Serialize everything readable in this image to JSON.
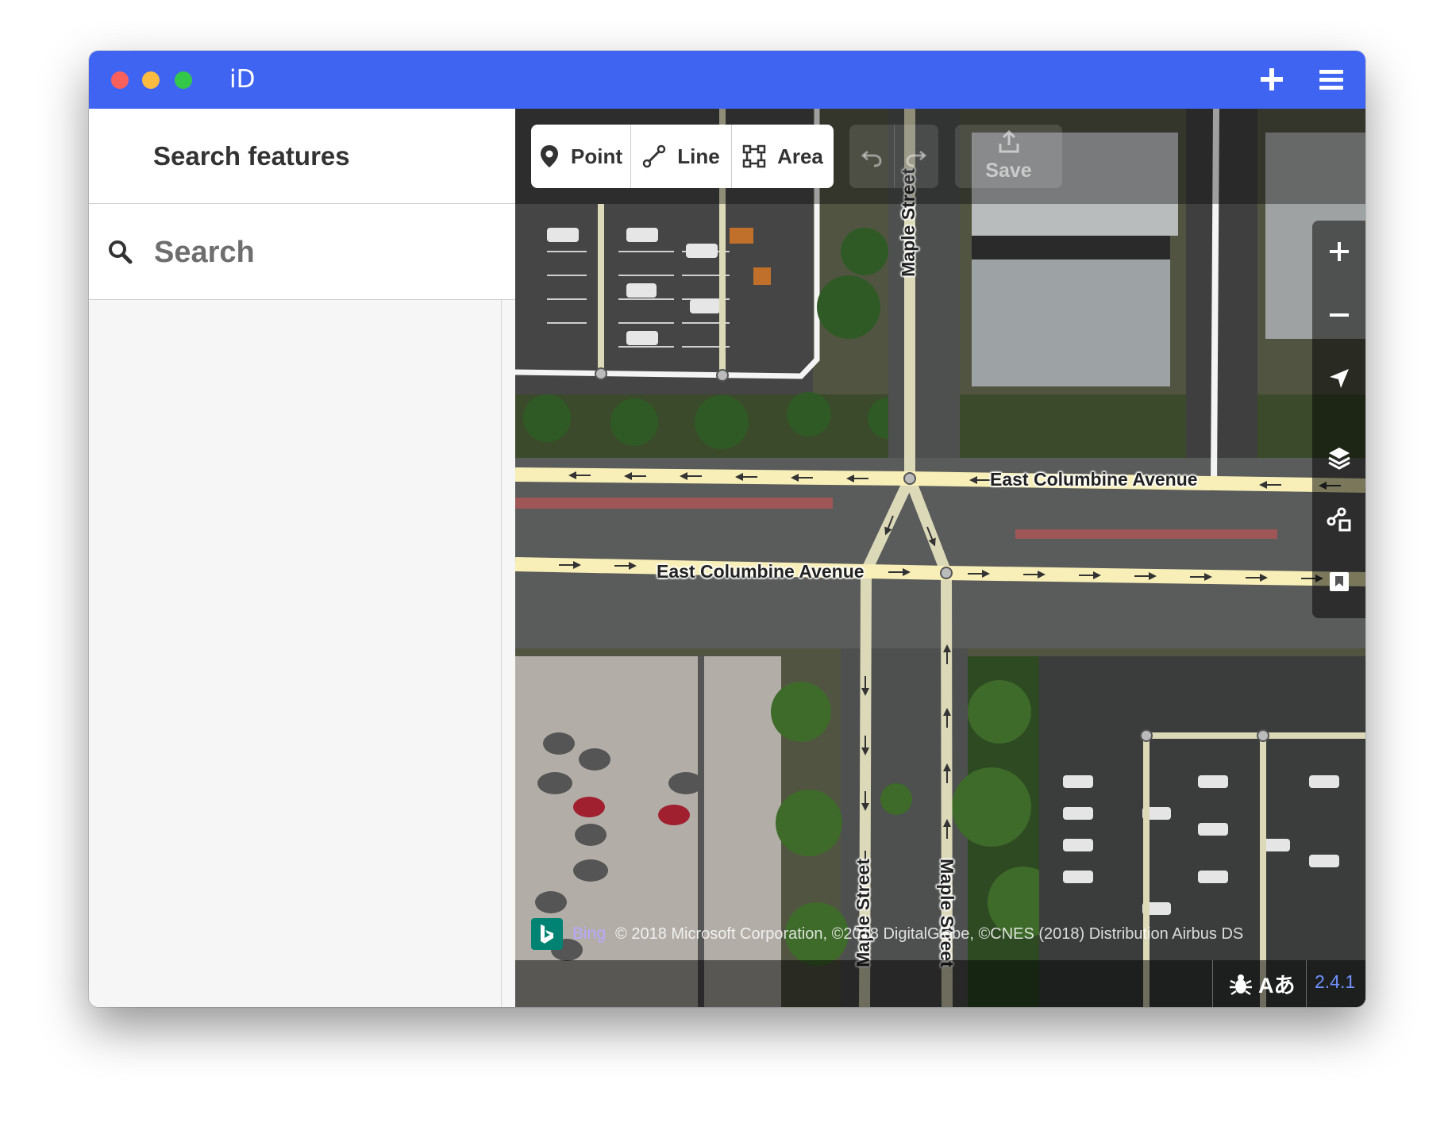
{
  "app": {
    "title": "iD"
  },
  "sidebar": {
    "title": "Search features",
    "search": {
      "placeholder": "Search",
      "value": ""
    }
  },
  "toolbar": {
    "modes": [
      {
        "label": "Point",
        "icon": "point-marker-icon"
      },
      {
        "label": "Line",
        "icon": "line-icon"
      },
      {
        "label": "Area",
        "icon": "area-icon"
      }
    ],
    "undo_icon": "undo-icon",
    "redo_icon": "redo-icon",
    "save_label": "Save",
    "save_icon": "save-upload-icon"
  },
  "map": {
    "road_labels": {
      "maple_north": "Maple Street",
      "columbine_north": "East Columbine Avenue",
      "columbine_south": "East Columbine Avenue",
      "maple_south_left": "Maple Street",
      "maple_south_right": "Maple Street"
    },
    "controls": [
      "zoom-in-icon",
      "zoom-out-icon",
      "geolocate-icon",
      "layers-icon",
      "map-data-icon",
      "help-icon"
    ],
    "attribution": {
      "provider": "Bing",
      "text": "© 2018 Microsoft Corporation, ©2018 DigitalGlobe, ©CNES (2018) Distribution Airbus DS"
    }
  },
  "footer": {
    "translate_label": "Aあ",
    "version": "2.4.1"
  },
  "colors": {
    "titlebar": "#4064f2",
    "road_primary": "#f7efb7",
    "road_residential": "#dcd9b9",
    "version_link": "#7092ff",
    "bing": "#008373"
  }
}
